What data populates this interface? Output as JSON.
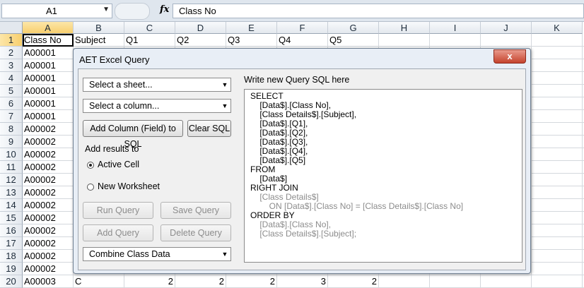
{
  "formula_bar": {
    "name_box": "A1",
    "fx_symbol": "fx",
    "formula_value": "Class No"
  },
  "sheet": {
    "columns": [
      "A",
      "B",
      "C",
      "D",
      "E",
      "F",
      "G",
      "H",
      "I",
      "J",
      "K"
    ],
    "rows": [
      "1",
      "2",
      "3",
      "4",
      "5",
      "6",
      "7",
      "8",
      "9",
      "10",
      "11",
      "12",
      "13",
      "14",
      "15",
      "16",
      "17",
      "18",
      "19",
      "20"
    ],
    "header_row": [
      "Class No",
      "Subject",
      "Q1",
      "Q2",
      "Q3",
      "Q4",
      "Q5"
    ],
    "class_col": [
      "A00001",
      "A00001",
      "A00001",
      "A00001",
      "A00001",
      "A00001",
      "A00002",
      "A00002",
      "A00002",
      "A00002",
      "A00002",
      "A00002",
      "A00002",
      "A00002",
      "A00002",
      "A00002",
      "A00002",
      "A00002",
      "A00003"
    ],
    "last_row": [
      "C",
      "2",
      "2",
      "2",
      "3",
      "2"
    ]
  },
  "dialog": {
    "title": "AET Excel Query",
    "close_label": "x",
    "sheet_select": "Select a sheet...",
    "column_select": "Select a column...",
    "add_column_button": "Add Column (Field) to SQL",
    "clear_sql_button": "Clear SQL",
    "add_results_label": "Add results to",
    "radio_active_cell": "Active Cell",
    "radio_new_worksheet": "New Worksheet",
    "run_query_button": "Run Query",
    "save_query_button": "Save Query",
    "add_query_button": "Add Query",
    "delete_query_button": "Delete Query",
    "query_select": "Combine Class Data",
    "sql_label": "Write new Query SQL here",
    "sql_lines": [
      "SELECT",
      "    [Data$].[Class No],",
      "    [Class Details$].[Subject],",
      "    [Data$].[Q1],",
      "    [Data$].[Q2],",
      "    [Data$].[Q3],",
      "    [Data$].[Q4],",
      "    [Data$].[Q5]",
      "FROM",
      "    [Data$]",
      "RIGHT JOIN",
      "    [Class Details$]",
      "        ON [Data$].[Class No] = [Class Details$].[Class No]",
      "ORDER BY",
      "    [Data$].[Class No],",
      "    [Class Details$].[Subject];"
    ]
  }
}
